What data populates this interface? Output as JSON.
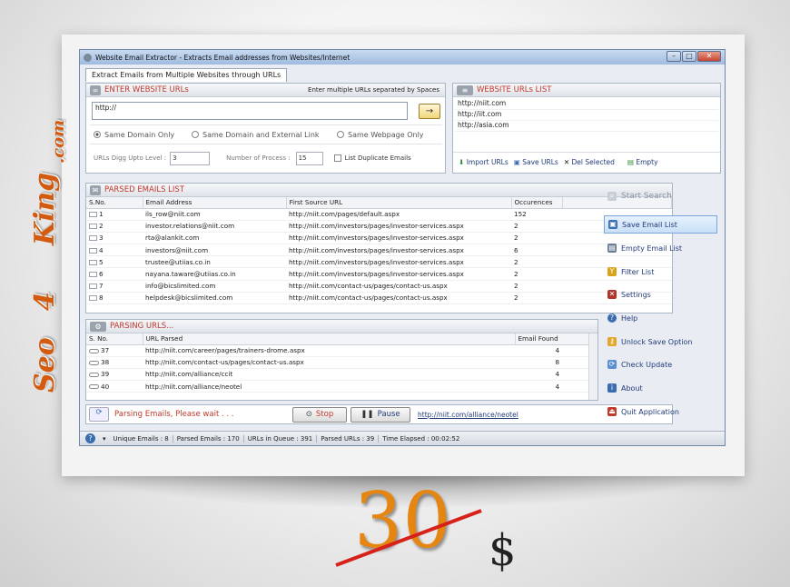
{
  "window": {
    "title": "Website Email Extractor - Extracts Email addresses from Websites/Internet",
    "min": "–",
    "max": "□",
    "close": "✕"
  },
  "tab": "Extract Emails from Multiple Websites through URLs",
  "enter_urls": {
    "title": "ENTER WEBSITE URLs",
    "hint": "Enter multiple URLs separated by Spaces",
    "input_value": "http://",
    "go": "→",
    "options": {
      "same_domain": "Same Domain Only",
      "same_domain_external": "Same Domain and External Link",
      "same_webpage": "Same Webpage Only"
    },
    "dig_label": "URLs Digg Upto Level :",
    "dig_value": "3",
    "process_label": "Number of Process :",
    "process_value": "15",
    "dup_label": "List Duplicate Emails"
  },
  "url_list": {
    "title": "WEBSITE URLs LIST",
    "items": [
      "http://niit.com",
      "http://iit.com",
      "http://asia.com"
    ],
    "import": "Import URLs",
    "save": "Save URLs",
    "del": "Del Selected",
    "empty": "Empty"
  },
  "parsed": {
    "title": "PARSED EMAILS LIST",
    "columns": [
      "S.No.",
      "Email Address",
      "First Source URL",
      "Occurences"
    ],
    "rows": [
      [
        "1",
        "ils_row@niit.com",
        "http://niit.com/pages/default.aspx",
        "152"
      ],
      [
        "2",
        "investor.relations@niit.com",
        "http://niit.com/investors/pages/investor-services.aspx",
        "2"
      ],
      [
        "3",
        "rta@alankit.com",
        "http://niit.com/investors/pages/investor-services.aspx",
        "2"
      ],
      [
        "4",
        "investors@niit.com",
        "http://niit.com/investors/pages/investor-services.aspx",
        "6"
      ],
      [
        "5",
        "trustee@utiias.co.in",
        "http://niit.com/investors/pages/investor-services.aspx",
        "2"
      ],
      [
        "6",
        "nayana.taware@utiias.co.in",
        "http://niit.com/investors/pages/investor-services.aspx",
        "2"
      ],
      [
        "7",
        "info@bicslimited.com",
        "http://niit.com/contact-us/pages/contact-us.aspx",
        "2"
      ],
      [
        "8",
        "helpdesk@bicslimited.com",
        "http://niit.com/contact-us/pages/contact-us.aspx",
        "2"
      ]
    ]
  },
  "parsing": {
    "title": "PARSING URLS...",
    "columns": [
      "S. No.",
      "URL Parsed",
      "Email Found"
    ],
    "rows": [
      [
        "37",
        "http://niit.com/career/pages/trainers-drome.aspx",
        "4"
      ],
      [
        "38",
        "http://niit.com/contact-us/pages/contact-us.aspx",
        "8"
      ],
      [
        "39",
        "http://niit.com/alliance/ccit",
        "4"
      ],
      [
        "40",
        "http://niit.com/alliance/neotel",
        "4"
      ]
    ]
  },
  "progress": {
    "status": "Parsing Emails, Please wait . . .",
    "stop": "Stop",
    "pause": "Pause",
    "current_url": "http://niit.com/alliance/neotel"
  },
  "side_menu": [
    "Start Search",
    "Save Email List",
    "Empty Email List",
    "Filter List",
    "Settings",
    "Help",
    "Unlock Save Option",
    "Check Update",
    "About",
    "Quit Application"
  ],
  "statusbar": {
    "unique": "Unique Emails : 8",
    "parsed": "Parsed Emails : 170",
    "queue": "URLs in Queue : 391",
    "parsed_urls": "Parsed URLs : 39",
    "elapsed": "Time Elapsed : 00:02:52"
  },
  "brand": {
    "seo": "Seo",
    "four": "4",
    "king": "King",
    "com": ".com"
  },
  "price": {
    "old": "30",
    "currency": "$"
  },
  "colors": {
    "accent": "#c0392b",
    "brand": "#d35b0f",
    "link": "#213a78"
  }
}
